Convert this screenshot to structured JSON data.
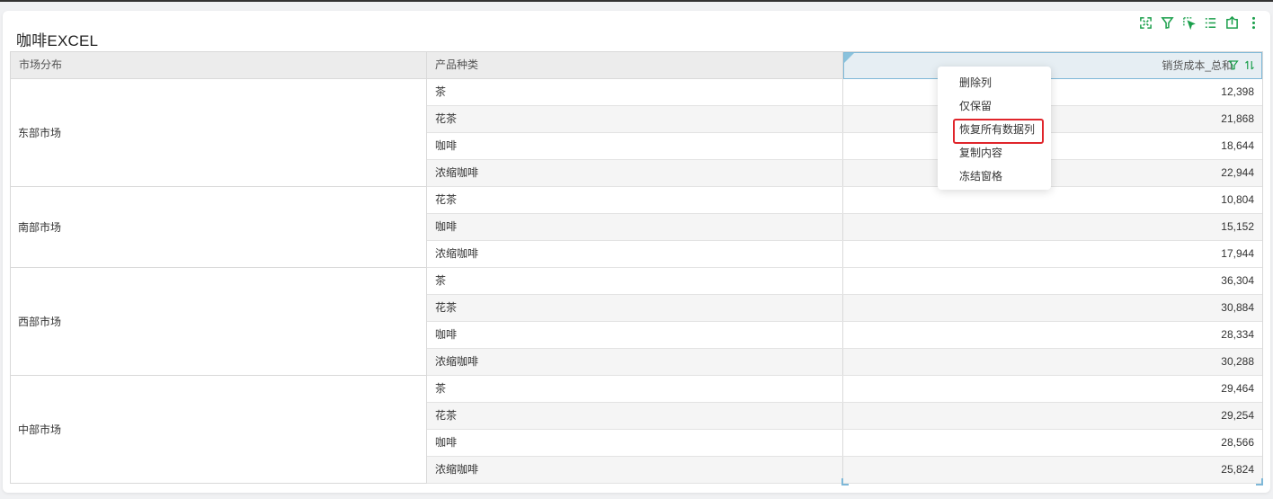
{
  "title": "咖啡EXCEL",
  "toolbar": {
    "icons": [
      "fullscreen-icon",
      "filter-icon",
      "select-icon",
      "list-icon",
      "export-icon",
      "more-icon"
    ],
    "accent_color": "#1a9f4b"
  },
  "table": {
    "headers": [
      "市场分布",
      "产品种类",
      "销货成本_总和"
    ],
    "regions": [
      {
        "name": "东部市场",
        "rows": [
          {
            "product": "茶",
            "value": "12,398"
          },
          {
            "product": "花茶",
            "value": "21,868"
          },
          {
            "product": "咖啡",
            "value": "18,644"
          },
          {
            "product": "浓缩咖啡",
            "value": "22,944"
          }
        ]
      },
      {
        "name": "南部市场",
        "rows": [
          {
            "product": "花茶",
            "value": "10,804"
          },
          {
            "product": "咖啡",
            "value": "15,152"
          },
          {
            "product": "浓缩咖啡",
            "value": "17,944"
          }
        ]
      },
      {
        "name": "西部市场",
        "rows": [
          {
            "product": "茶",
            "value": "36,304"
          },
          {
            "product": "花茶",
            "value": "30,884"
          },
          {
            "product": "咖啡",
            "value": "28,334"
          },
          {
            "product": "浓缩咖啡",
            "value": "30,288"
          }
        ]
      },
      {
        "name": "中部市场",
        "rows": [
          {
            "product": "茶",
            "value": "29,464"
          },
          {
            "product": "花茶",
            "value": "29,254"
          },
          {
            "product": "咖啡",
            "value": "28,566"
          },
          {
            "product": "浓缩咖啡",
            "value": "25,824"
          }
        ]
      }
    ]
  },
  "context_menu": {
    "items": [
      "删除列",
      "仅保留",
      "恢复所有数据列",
      "复制内容",
      "冻结窗格"
    ],
    "highlighted": "恢复所有数据列",
    "highlight_color": "#e0252b"
  }
}
